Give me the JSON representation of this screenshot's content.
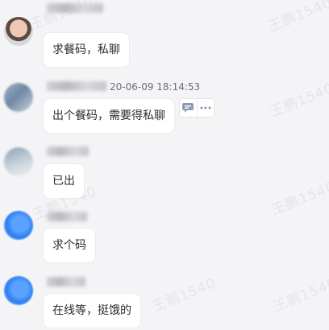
{
  "watermark": {
    "text": "王鹏1540"
  },
  "messages": [
    {
      "avatar_style": "photo-a",
      "text": "求餐码，私聊"
    },
    {
      "avatar_style": "photo-b",
      "timestamp": "20-06-09 18:14:53",
      "text": "出个餐码，需要得私聊",
      "actions": [
        {
          "icon": "quote-reply-icon"
        },
        {
          "icon": "more-icon"
        }
      ]
    },
    {
      "avatar_style": "photo-c",
      "text": "已出"
    },
    {
      "avatar_style": "blue",
      "text": "求个码"
    },
    {
      "avatar_style": "blue",
      "text": "在线等，挺饿的"
    }
  ],
  "colors": {
    "background": "#f4f4f6",
    "bubble": "#ffffff",
    "text": "#2b2b33",
    "icon_accent": "#8c9bb5"
  }
}
